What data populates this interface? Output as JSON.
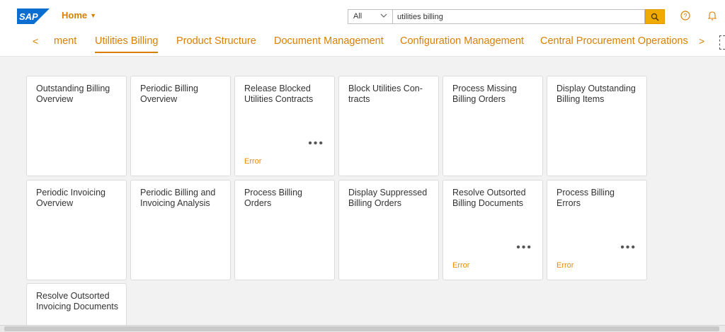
{
  "shell": {
    "logo_text": "SAP",
    "home_label": "Home",
    "search_scope": "All",
    "search_value": "utilities billing",
    "icons": [
      "search-icon",
      "help-icon",
      "bell-icon"
    ],
    "colors": {
      "accent": "#d97f00",
      "logo": "#0a6ed1",
      "search_button": "#f0ab00",
      "error": "#e78c07"
    }
  },
  "tabs": {
    "items": [
      {
        "label": "ment"
      },
      {
        "label": "Utilities Billing",
        "active": true
      },
      {
        "label": "Product Structure"
      },
      {
        "label": "Document Management"
      },
      {
        "label": "Configuration Management"
      },
      {
        "label": "Central Procurement Operations"
      }
    ],
    "prev_arrow": "<",
    "next_arrow": ">"
  },
  "tiles": [
    {
      "title": "Outstanding Billing Overview"
    },
    {
      "title": "Periodic Billing Overview"
    },
    {
      "title": "Release Blocked Utilities Contracts",
      "dots": "•••",
      "status": "Error"
    },
    {
      "title": "Block Utilities Con­tracts"
    },
    {
      "title": "Process Missing Billing Orders"
    },
    {
      "title": "Display Outstanding Billing Items"
    },
    {
      "title": "Periodic Invoicing Overview"
    },
    {
      "title": "Periodic Billing and Invoicing Analysis"
    },
    {
      "title": "Process Billing Orders"
    },
    {
      "title": "Display Suppressed Billing Orders"
    },
    {
      "title": "Resolve Outsorted Billing Documents",
      "dots": "•••",
      "status": "Error"
    },
    {
      "title": "Process Billing Errors",
      "dots": "•••",
      "status": "Error"
    },
    {
      "title": "Resolve Outsorted Invoicing Docu­ments"
    }
  ]
}
